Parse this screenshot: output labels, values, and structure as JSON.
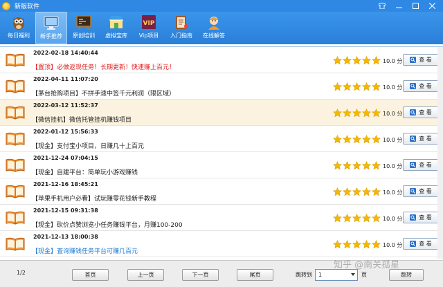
{
  "window": {
    "title": "新版软件",
    "controls": [
      "shirt-icon",
      "minimize",
      "maximize",
      "close"
    ]
  },
  "toolbar": [
    {
      "label": "每日福利",
      "icon": "owl-icon",
      "active": false
    },
    {
      "label": "新手推荐",
      "icon": "monitor-icon",
      "active": true
    },
    {
      "label": "原创培训",
      "icon": "blackboard-icon",
      "active": false
    },
    {
      "label": "虚拟宝库",
      "icon": "shop-icon",
      "active": false
    },
    {
      "label": "Vip项目",
      "icon": "vip-icon",
      "active": false
    },
    {
      "label": "入门指南",
      "icon": "guide-icon",
      "active": false
    },
    {
      "label": "在线解答",
      "icon": "support-agent-icon",
      "active": false
    }
  ],
  "items": [
    {
      "date": "2022-02-18 14:40:44",
      "title": "【置顶】必做返现任务！长期更新！快速赚上百元！",
      "style": "red",
      "score": "10.0 分",
      "stars": 5
    },
    {
      "date": "2022-04-11 11:07:20",
      "title": "【茅台抢购项目】不拼手速中签千元利润（限区域）",
      "style": "normal",
      "score": "10.0 分",
      "stars": 5
    },
    {
      "date": "2022-03-12 11:52:37",
      "title": "【微信挂机】微信托管挂机赚钱项目",
      "style": "normal",
      "score": "10.0 分",
      "stars": 5,
      "selected": true
    },
    {
      "date": "2022-01-12 15:56:33",
      "title": "【现金】支付宝小项目，日赚几十上百元",
      "style": "normal",
      "score": "10.0 分",
      "stars": 5
    },
    {
      "date": "2021-12-24 07:04:15",
      "title": "【现金】自建平台：简单玩小游戏赚钱",
      "style": "normal",
      "score": "10.0 分",
      "stars": 5
    },
    {
      "date": "2021-12-16 18:45:21",
      "title": "【苹果手机用户必看】试玩赚零花钱新手教程",
      "style": "normal",
      "score": "10.0 分",
      "stars": 5
    },
    {
      "date": "2021-12-15 09:31:38",
      "title": "【现金】砍价点赞浏览小任务赚钱平台，月赚100-200",
      "style": "normal",
      "score": "10.0 分",
      "stars": 5
    },
    {
      "date": "2021-12-13 18:00:38",
      "title": "【现金】查询赚钱任务平台可赚几百元",
      "style": "blue",
      "score": "10.0 分",
      "stars": 5
    }
  ],
  "view_label": "查 看",
  "footer": {
    "page_info": "1/2",
    "first": "首页",
    "prev": "上一页",
    "next": "下一页",
    "last": "尾页",
    "jump_label": "跳转到",
    "jump_value": "1",
    "page_unit": "页",
    "jump_button": "跳转"
  },
  "watermark": "知乎 @南关孤星",
  "colors": {
    "titlebar": "#2f89e4",
    "star": "#f5b800",
    "highlight_row": "#fbf3df"
  }
}
